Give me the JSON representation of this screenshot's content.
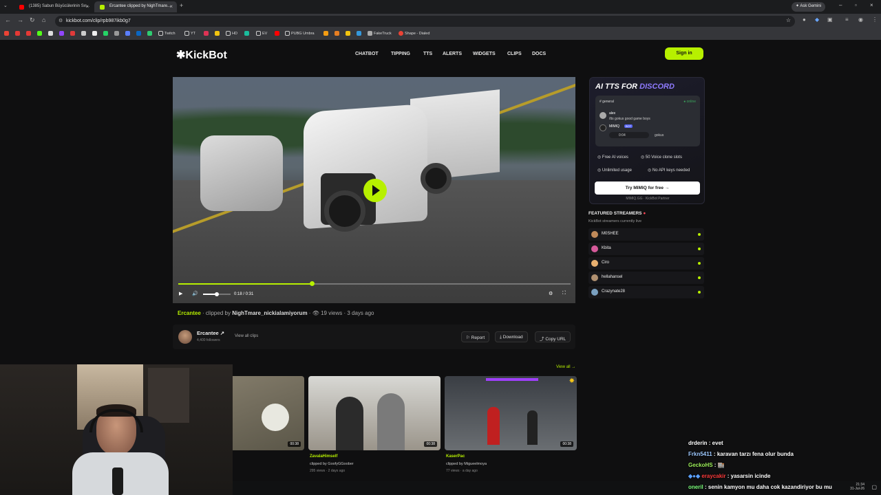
{
  "browser": {
    "tabs": [
      {
        "label": "(1385) Sabun Büyücülerinin Sır..."
      },
      {
        "label": "Ercantee clipped by NighTmare..."
      }
    ],
    "ask_label": "Ask Gemini",
    "url": "kickbot.com/clip/rpb987ikb0g7",
    "bookmarks": [
      "Twitch",
      "YT",
      "HD",
      "EV",
      "PUBG Umbra",
      "FakeTruck",
      "Shape - Dialed"
    ]
  },
  "site": {
    "logo": "KickBot",
    "nav": [
      "CHATBOT",
      "TIPPING",
      "TTS",
      "ALERTS",
      "WIDGETS",
      "CLIPS",
      "DOCS"
    ],
    "signin": "Sign in"
  },
  "player": {
    "time": "0:18 / 0:31",
    "progress": 0.34,
    "volume": 0.5
  },
  "clip": {
    "streamer": "Ercantee",
    "clipped_by_prefix": "· clipped by",
    "clipper": "NighTmare_nickialamiyorum",
    "views": "19 views",
    "ago": "3 days ago",
    "channel_name": "Ercantee",
    "followers": "4,400 followers",
    "view_all": "View all clips",
    "report": "Report",
    "download": "Download",
    "copy_url": "Copy URL"
  },
  "ad": {
    "title_a": "AI TTS FOR",
    "title_b": "DISCORD",
    "channel": "general",
    "status": "online",
    "user1": "alex",
    "msg1": "/tts gokus good game boys",
    "user2": "MIMIQ",
    "bot_tag": "BOT",
    "audio_time": "0:04",
    "audio_user": "gokus",
    "features": [
      "Free AI voices",
      "50 Voice clone slots",
      "Unlimited usage",
      "No API keys needed"
    ],
    "cta": "Try MIMIQ for free →",
    "partner": "MIMIQ.GG · KickBot Partner"
  },
  "featured": {
    "title": "FEATURED STREAMERS",
    "subtitle": "KickBot streamers currently live",
    "streamers": [
      "M0SHEE",
      "Kbita",
      "Ciro",
      "hellahansel",
      "Crazynate28"
    ]
  },
  "more_clips": {
    "view_all": "View all →",
    "clips": [
      {
        "duration": "00:38",
        "title": "",
        "clipper": "",
        "meta": ""
      },
      {
        "duration": "00:38",
        "title": "ZavalaHimself",
        "clipper": "clipped by GoofyGGoober",
        "meta": "295 views · 2 days ago"
      },
      {
        "duration": "00:38",
        "title": "KaserPac",
        "clipper": "clipped by Migueelmoya",
        "meta": "77 views · a day ago"
      }
    ]
  },
  "chat": [
    {
      "user": "drderin",
      "text": " : evet",
      "color": "#ffffff"
    },
    {
      "user": "Frkn5411",
      "text": " : karavan tarzı fena olur bunda",
      "color": "#9ec9ff"
    },
    {
      "user": "GeckoHS",
      "text": " : 🏬",
      "color": "#9ef05a"
    },
    {
      "user": "eraycakir",
      "text": " : yasarsin icinde",
      "color": "#ff3b3b"
    },
    {
      "user": "oneril",
      "text": " : senin kamyon mu daha cok kazandiriyor bu mu",
      "color": "#7cff7c"
    }
  ],
  "clock": {
    "time": "21:34",
    "date": "31-Jul-26"
  },
  "colors": {
    "accent": "#b7f000",
    "purple": "#8f7bff",
    "background": "#0f0f10"
  }
}
